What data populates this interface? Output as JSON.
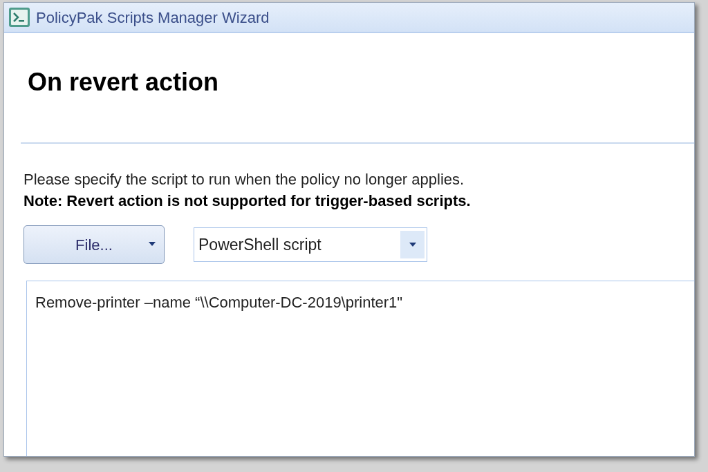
{
  "window": {
    "title": "PolicyPak Scripts Manager Wizard"
  },
  "page": {
    "heading": "On revert action",
    "description": "Please specify the script to run when the policy no longer applies.",
    "note": "Note: Revert action is not supported for trigger-based scripts."
  },
  "file_button": {
    "label": "File..."
  },
  "script_type": {
    "value": "PowerShell script"
  },
  "script_editor": {
    "value": "Remove-printer –name “\\\\Computer-DC-2019\\printer1\""
  }
}
